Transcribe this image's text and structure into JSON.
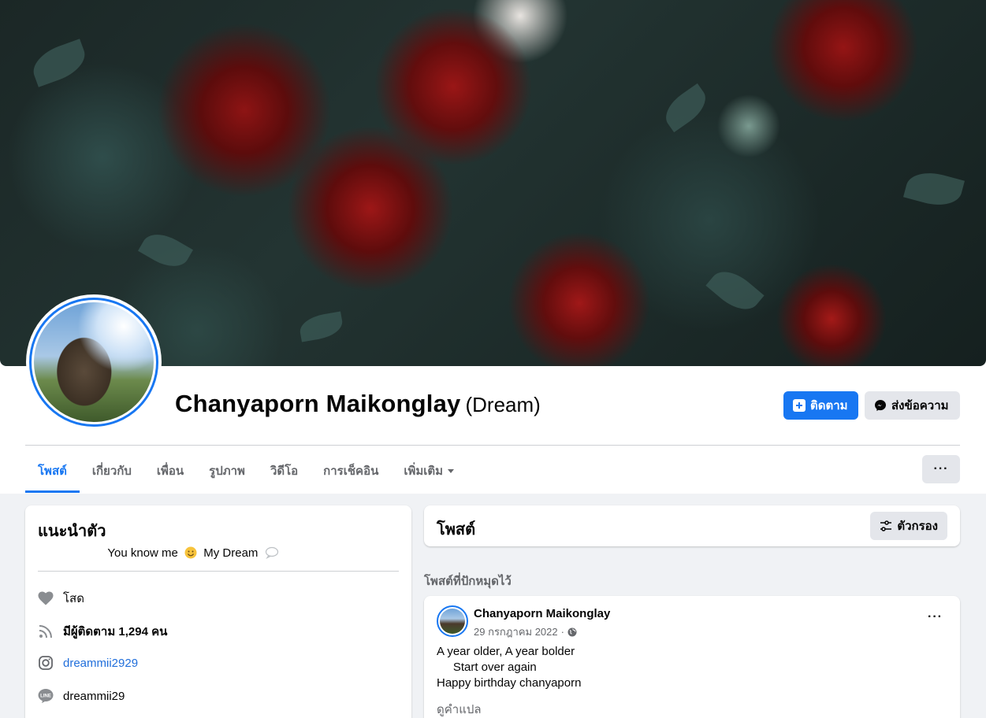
{
  "profile": {
    "name": "Chanyaporn Maikonglay",
    "alt_name": "(Dream)",
    "follow_label": "ติดตาม",
    "message_label": "ส่งข้อความ"
  },
  "tabs": [
    {
      "label": "โพสต์",
      "active": true
    },
    {
      "label": "เกี่ยวกับ"
    },
    {
      "label": "เพื่อน"
    },
    {
      "label": "รูปภาพ"
    },
    {
      "label": "วิดีโอ"
    },
    {
      "label": "การเช็คอิน"
    },
    {
      "label": "เพิ่มเติม"
    }
  ],
  "more_label": "···",
  "intro": {
    "title": "แนะนำตัว",
    "bio_1": "You know me",
    "bio_2": "My Dream",
    "relationship": "โสด",
    "followers_prefix": "มีผู้ติดตาม",
    "followers_count": "1,294 คน",
    "instagram": "dreammii2929",
    "line": "dreammii29"
  },
  "posts": {
    "title": "โพสต์",
    "filter_label": "ตัวกรอง",
    "pinned_label": "โพสต์ที่ปักหมุดไว้"
  },
  "post": {
    "author": "Chanyaporn Maikonglay",
    "date": "29 กรกฎาคม 2022",
    "separator": "·",
    "line1": "A year older, A year bolder",
    "line2": "     Start over again",
    "line3": "Happy birthday chanyaporn",
    "translate": "ดูคำแปล",
    "dots": "···"
  },
  "colors": {
    "accent": "#1877f2",
    "background": "#f0f2f5",
    "button_gray": "#e4e6eb",
    "muted_text": "#65676b"
  },
  "icons": {
    "relationship": "heart-icon",
    "followers": "rss-icon",
    "instagram": "instagram-icon",
    "line": "line-icon",
    "messenger": "messenger-icon",
    "globe": "globe-icon"
  }
}
